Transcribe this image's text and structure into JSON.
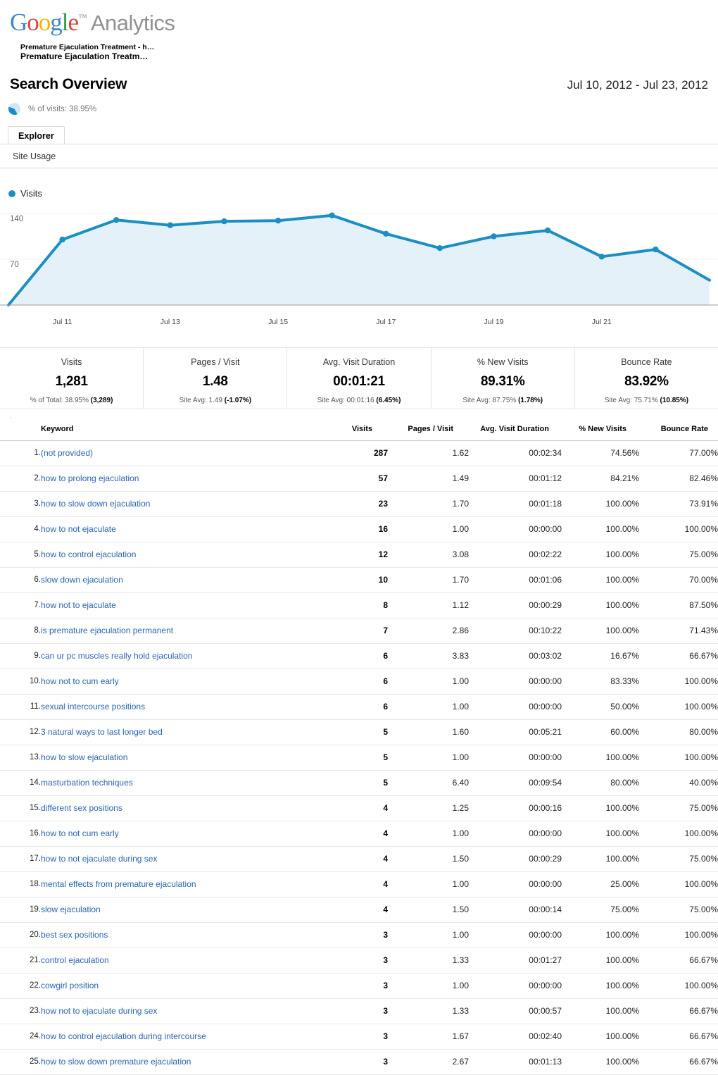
{
  "brand": {
    "google": "Google",
    "tm": "™",
    "analytics": "Analytics"
  },
  "account": {
    "line1": "Premature Ejaculation Treatment - h…",
    "line2": "Premature Ejaculation Treatm…"
  },
  "header": {
    "title": "Search Overview",
    "date_range": "Jul 10, 2012 - Jul 23, 2012",
    "pct_of_visits": "% of visits: 38.95%",
    "pie_icon": "pie-chart-icon"
  },
  "tabs": [
    {
      "label": "Explorer",
      "selected": true
    }
  ],
  "subnav": {
    "site_usage": "Site Usage"
  },
  "chart_data": {
    "type": "area",
    "title": "",
    "legend": [
      "Visits"
    ],
    "legend_position": "top-left",
    "series_color": "#1b8fc4",
    "fill_color": "#e4f1f8",
    "grid": true,
    "xlabel": "",
    "ylabel": "",
    "ylim": [
      0,
      140
    ],
    "yticks": [
      70,
      140
    ],
    "ytick_labels": [
      "70",
      "140"
    ],
    "x": [
      "Jul 10",
      "Jul 11",
      "Jul 12",
      "Jul 13",
      "Jul 14",
      "Jul 15",
      "Jul 16",
      "Jul 17",
      "Jul 18",
      "Jul 19",
      "Jul 20",
      "Jul 21",
      "Jul 22",
      "Jul 23"
    ],
    "xtick_labels": [
      "Jul 11",
      "Jul 13",
      "Jul 15",
      "Jul 17",
      "Jul 19",
      "Jul 21"
    ],
    "xtick_indices": [
      1,
      3,
      5,
      7,
      9,
      11
    ],
    "series": [
      {
        "name": "Visits",
        "values": [
          0,
          100,
          130,
          122,
          128,
          129,
          137,
          109,
          87,
          105,
          114,
          74,
          85,
          38
        ]
      }
    ]
  },
  "metrics": [
    {
      "label": "Visits",
      "value": "1,281",
      "sub_prefix": "% of Total: 38.95% ",
      "sub_bold": "(3,289)"
    },
    {
      "label": "Pages / Visit",
      "value": "1.48",
      "sub_prefix": "Site Avg: 1.49 ",
      "sub_bold": "(-1.07%)"
    },
    {
      "label": "Avg. Visit Duration",
      "value": "00:01:21",
      "sub_prefix": "Site Avg: 00:01:16 ",
      "sub_bold": "(6.45%)"
    },
    {
      "label": "% New Visits",
      "value": "89.31%",
      "sub_prefix": "Site Avg: 87.75% ",
      "sub_bold": "(1.78%)"
    },
    {
      "label": "Bounce Rate",
      "value": "83.92%",
      "sub_prefix": "Site Avg: 75.71% ",
      "sub_bold": "(10.85%)"
    }
  ],
  "table": {
    "columns": [
      "Keyword",
      "Visits",
      "Pages / Visit",
      "Avg. Visit Duration",
      "% New Visits",
      "Bounce Rate"
    ],
    "rows": [
      {
        "idx": "1.",
        "keyword": "(not provided)",
        "visits": "287",
        "pages_visit": "1.62",
        "avg_duration": "00:02:34",
        "new_visits": "74.56%",
        "bounce_rate": "77.00%"
      },
      {
        "idx": "2.",
        "keyword": "how to prolong ejaculation",
        "visits": "57",
        "pages_visit": "1.49",
        "avg_duration": "00:01:12",
        "new_visits": "84.21%",
        "bounce_rate": "82.46%"
      },
      {
        "idx": "3.",
        "keyword": "how to slow down ejaculation",
        "visits": "23",
        "pages_visit": "1.70",
        "avg_duration": "00:01:18",
        "new_visits": "100.00%",
        "bounce_rate": "73.91%"
      },
      {
        "idx": "4.",
        "keyword": "how to not ejaculate",
        "visits": "16",
        "pages_visit": "1.00",
        "avg_duration": "00:00:00",
        "new_visits": "100.00%",
        "bounce_rate": "100.00%"
      },
      {
        "idx": "5.",
        "keyword": "how to control ejaculation",
        "visits": "12",
        "pages_visit": "3.08",
        "avg_duration": "00:02:22",
        "new_visits": "100.00%",
        "bounce_rate": "75.00%"
      },
      {
        "idx": "6.",
        "keyword": "slow down ejaculation",
        "visits": "10",
        "pages_visit": "1.70",
        "avg_duration": "00:01:06",
        "new_visits": "100.00%",
        "bounce_rate": "70.00%"
      },
      {
        "idx": "7.",
        "keyword": "how not to ejaculate",
        "visits": "8",
        "pages_visit": "1.12",
        "avg_duration": "00:00:29",
        "new_visits": "100.00%",
        "bounce_rate": "87.50%"
      },
      {
        "idx": "8.",
        "keyword": "is premature ejaculation permanent",
        "visits": "7",
        "pages_visit": "2.86",
        "avg_duration": "00:10:22",
        "new_visits": "100.00%",
        "bounce_rate": "71.43%"
      },
      {
        "idx": "9.",
        "keyword": "can ur pc muscles really hold ejaculation",
        "visits": "6",
        "pages_visit": "3.83",
        "avg_duration": "00:03:02",
        "new_visits": "16.67%",
        "bounce_rate": "66.67%"
      },
      {
        "idx": "10.",
        "keyword": "how not to cum early",
        "visits": "6",
        "pages_visit": "1.00",
        "avg_duration": "00:00:00",
        "new_visits": "83.33%",
        "bounce_rate": "100.00%"
      },
      {
        "idx": "11.",
        "keyword": "sexual intercourse positions",
        "visits": "6",
        "pages_visit": "1.00",
        "avg_duration": "00:00:00",
        "new_visits": "50.00%",
        "bounce_rate": "100.00%"
      },
      {
        "idx": "12.",
        "keyword": "3 natural ways to last longer bed",
        "visits": "5",
        "pages_visit": "1.60",
        "avg_duration": "00:05:21",
        "new_visits": "60.00%",
        "bounce_rate": "80.00%"
      },
      {
        "idx": "13.",
        "keyword": "how to slow ejaculation",
        "visits": "5",
        "pages_visit": "1.00",
        "avg_duration": "00:00:00",
        "new_visits": "100.00%",
        "bounce_rate": "100.00%"
      },
      {
        "idx": "14.",
        "keyword": "masturbation techniques",
        "visits": "5",
        "pages_visit": "6.40",
        "avg_duration": "00:09:54",
        "new_visits": "80.00%",
        "bounce_rate": "40.00%"
      },
      {
        "idx": "15.",
        "keyword": "different sex positions",
        "visits": "4",
        "pages_visit": "1.25",
        "avg_duration": "00:00:16",
        "new_visits": "100.00%",
        "bounce_rate": "75.00%"
      },
      {
        "idx": "16.",
        "keyword": "how to not cum early",
        "visits": "4",
        "pages_visit": "1.00",
        "avg_duration": "00:00:00",
        "new_visits": "100.00%",
        "bounce_rate": "100.00%"
      },
      {
        "idx": "17.",
        "keyword": "how to not ejaculate during sex",
        "visits": "4",
        "pages_visit": "1.50",
        "avg_duration": "00:00:29",
        "new_visits": "100.00%",
        "bounce_rate": "75.00%"
      },
      {
        "idx": "18.",
        "keyword": "mental effects from premature ejaculation",
        "visits": "4",
        "pages_visit": "1.00",
        "avg_duration": "00:00:00",
        "new_visits": "25.00%",
        "bounce_rate": "100.00%"
      },
      {
        "idx": "19.",
        "keyword": "slow ejaculation",
        "visits": "4",
        "pages_visit": "1.50",
        "avg_duration": "00:00:14",
        "new_visits": "75.00%",
        "bounce_rate": "75.00%"
      },
      {
        "idx": "20.",
        "keyword": "best sex positions",
        "visits": "3",
        "pages_visit": "1.00",
        "avg_duration": "00:00:00",
        "new_visits": "100.00%",
        "bounce_rate": "100.00%"
      },
      {
        "idx": "21.",
        "keyword": "control ejaculation",
        "visits": "3",
        "pages_visit": "1.33",
        "avg_duration": "00:01:27",
        "new_visits": "100.00%",
        "bounce_rate": "66.67%"
      },
      {
        "idx": "22.",
        "keyword": "cowgirl position",
        "visits": "3",
        "pages_visit": "1.00",
        "avg_duration": "00:00:00",
        "new_visits": "100.00%",
        "bounce_rate": "100.00%"
      },
      {
        "idx": "23.",
        "keyword": "how not to ejaculate during sex",
        "visits": "3",
        "pages_visit": "1.33",
        "avg_duration": "00:00:57",
        "new_visits": "100.00%",
        "bounce_rate": "66.67%"
      },
      {
        "idx": "24.",
        "keyword": "how to control ejaculation during intercourse",
        "visits": "3",
        "pages_visit": "1.67",
        "avg_duration": "00:02:40",
        "new_visits": "100.00%",
        "bounce_rate": "66.67%"
      },
      {
        "idx": "25.",
        "keyword": "how to slow down premature ejaculation",
        "visits": "3",
        "pages_visit": "2.67",
        "avg_duration": "00:01:13",
        "new_visits": "100.00%",
        "bounce_rate": "66.67%"
      }
    ]
  }
}
